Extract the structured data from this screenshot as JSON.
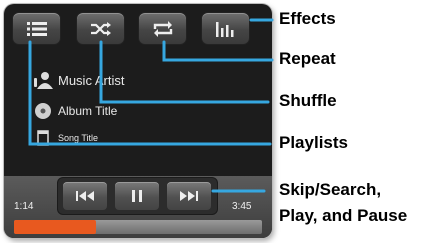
{
  "player": {
    "buttons": [
      {
        "name": "playlists",
        "icon": "list-icon"
      },
      {
        "name": "shuffle",
        "icon": "shuffle-icon"
      },
      {
        "name": "repeat",
        "icon": "repeat-icon"
      },
      {
        "name": "effects",
        "icon": "equalizer-icon"
      }
    ],
    "artist": "Music Artist",
    "album": "Album Title",
    "song": "Song Title",
    "time_elapsed": "1:14",
    "time_total": "3:45",
    "progress": 0.33,
    "controls": [
      {
        "name": "previous",
        "icon": "skip-back-icon"
      },
      {
        "name": "pause",
        "icon": "pause-icon"
      },
      {
        "name": "next",
        "icon": "skip-forward-icon"
      }
    ],
    "accent_color": "#e8591f"
  },
  "callouts": {
    "effects": "Effects",
    "repeat": "Repeat",
    "shuffle": "Shuffle",
    "playlists": "Playlists",
    "controls_line1": "Skip/Search,",
    "controls_line2": "Play, and Pause"
  }
}
